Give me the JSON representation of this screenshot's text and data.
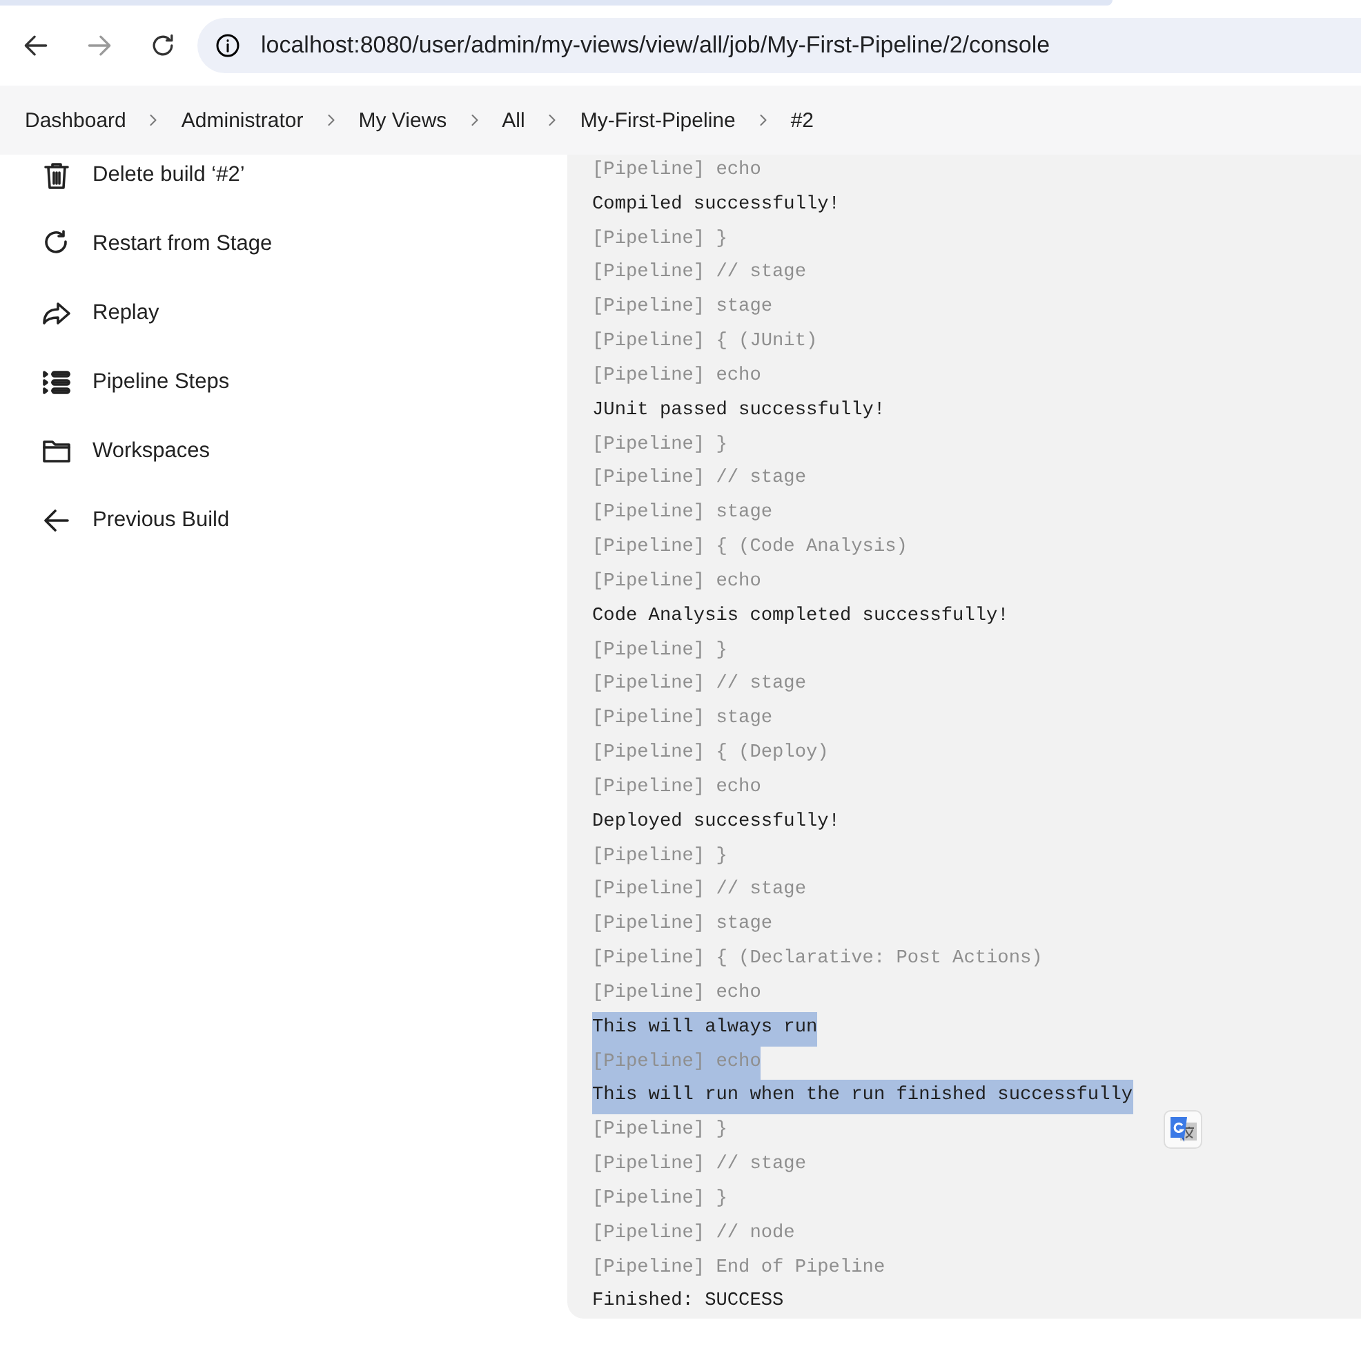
{
  "browser": {
    "url": "localhost:8080/user/admin/my-views/view/all/job/My-First-Pipeline/2/console",
    "nav": [
      {
        "kind": "back",
        "disabled": false
      },
      {
        "kind": "forward",
        "disabled": true
      },
      {
        "kind": "reload",
        "disabled": false
      }
    ]
  },
  "breadcrumbs": [
    "Dashboard",
    "Administrator",
    "My Views",
    "All",
    "My-First-Pipeline",
    "#2"
  ],
  "sidebar": {
    "items": [
      {
        "label": "Delete build ‘#2’"
      },
      {
        "label": "Restart from Stage"
      },
      {
        "label": "Replay"
      },
      {
        "label": "Pipeline Steps"
      },
      {
        "label": "Workspaces"
      },
      {
        "label": "Previous Build"
      }
    ]
  },
  "console": {
    "lines": [
      {
        "text": "[Pipeline] echo",
        "kind": "pipeline",
        "selected": false
      },
      {
        "text": "Compiled successfully!",
        "kind": "output",
        "selected": false
      },
      {
        "text": "[Pipeline] }",
        "kind": "pipeline",
        "selected": false
      },
      {
        "text": "[Pipeline] // stage",
        "kind": "pipeline",
        "selected": false
      },
      {
        "text": "[Pipeline] stage",
        "kind": "pipeline",
        "selected": false
      },
      {
        "text": "[Pipeline] { (JUnit)",
        "kind": "pipeline",
        "selected": false
      },
      {
        "text": "[Pipeline] echo",
        "kind": "pipeline",
        "selected": false
      },
      {
        "text": "JUnit passed successfully!",
        "kind": "output",
        "selected": false
      },
      {
        "text": "[Pipeline] }",
        "kind": "pipeline",
        "selected": false
      },
      {
        "text": "[Pipeline] // stage",
        "kind": "pipeline",
        "selected": false
      },
      {
        "text": "[Pipeline] stage",
        "kind": "pipeline",
        "selected": false
      },
      {
        "text": "[Pipeline] { (Code Analysis)",
        "kind": "pipeline",
        "selected": false
      },
      {
        "text": "[Pipeline] echo",
        "kind": "pipeline",
        "selected": false
      },
      {
        "text": "Code Analysis completed successfully!",
        "kind": "output",
        "selected": false
      },
      {
        "text": "[Pipeline] }",
        "kind": "pipeline",
        "selected": false
      },
      {
        "text": "[Pipeline] // stage",
        "kind": "pipeline",
        "selected": false
      },
      {
        "text": "[Pipeline] stage",
        "kind": "pipeline",
        "selected": false
      },
      {
        "text": "[Pipeline] { (Deploy)",
        "kind": "pipeline",
        "selected": false
      },
      {
        "text": "[Pipeline] echo",
        "kind": "pipeline",
        "selected": false
      },
      {
        "text": "Deployed successfully!",
        "kind": "output",
        "selected": false
      },
      {
        "text": "[Pipeline] }",
        "kind": "pipeline",
        "selected": false
      },
      {
        "text": "[Pipeline] // stage",
        "kind": "pipeline",
        "selected": false
      },
      {
        "text": "[Pipeline] stage",
        "kind": "pipeline",
        "selected": false
      },
      {
        "text": "[Pipeline] { (Declarative: Post Actions)",
        "kind": "pipeline",
        "selected": false
      },
      {
        "text": "[Pipeline] echo",
        "kind": "pipeline",
        "selected": false
      },
      {
        "text": "This will always run",
        "kind": "output",
        "selected": true
      },
      {
        "text": "[Pipeline] echo",
        "kind": "pipeline",
        "selected": true
      },
      {
        "text": "This will run when the run finished successfully",
        "kind": "output",
        "selected": true
      },
      {
        "text": "[Pipeline] }",
        "kind": "pipeline",
        "selected": false
      },
      {
        "text": "[Pipeline] // stage",
        "kind": "pipeline",
        "selected": false
      },
      {
        "text": "[Pipeline] }",
        "kind": "pipeline",
        "selected": false
      },
      {
        "text": "[Pipeline] // node",
        "kind": "pipeline",
        "selected": false
      },
      {
        "text": "[Pipeline] End of Pipeline",
        "kind": "pipeline",
        "selected": false
      },
      {
        "text": "Finished: SUCCESS",
        "kind": "output",
        "selected": false
      }
    ]
  }
}
